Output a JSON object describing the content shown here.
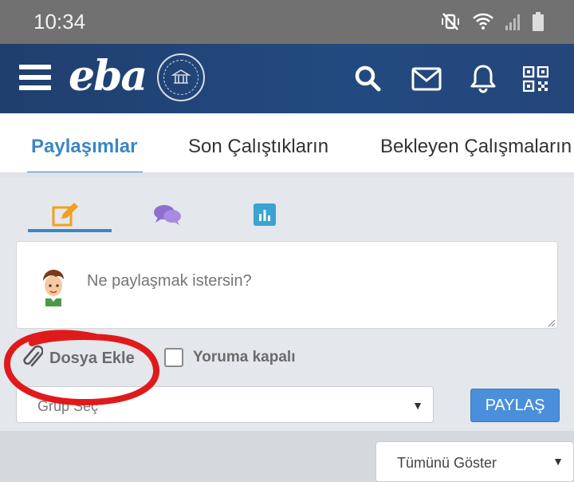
{
  "status_bar": {
    "time": "10:34",
    "icons": [
      "mute-vibrate-icon",
      "wifi-icon",
      "signal-icon",
      "battery-icon"
    ]
  },
  "header": {
    "logo": "eba",
    "icons": [
      "menu-icon",
      "search-icon",
      "mail-icon",
      "bell-icon",
      "qr-code-icon"
    ],
    "colors": {
      "background": "#1f3f6e",
      "accent": "#3a86c8"
    }
  },
  "tabs": [
    {
      "label": "Paylaşımlar",
      "active": true
    },
    {
      "label": "Son Çalıştıkların",
      "active": false
    },
    {
      "label": "Bekleyen Çalışmaların",
      "active": false
    }
  ],
  "composer": {
    "mode_icons": [
      "edit-icon",
      "chat-bubbles-icon",
      "bar-chart-icon"
    ],
    "placeholder": "Ne paylaşmak istersin?",
    "attach_label": "Dosya Ekle",
    "comments_closed_label": "Yoruma kapalı",
    "comments_closed_checked": false,
    "group_select_value": "Grup Seç",
    "share_label": "PAYLAŞ"
  },
  "filter": {
    "show_select_value": "Tümünü Göster"
  }
}
